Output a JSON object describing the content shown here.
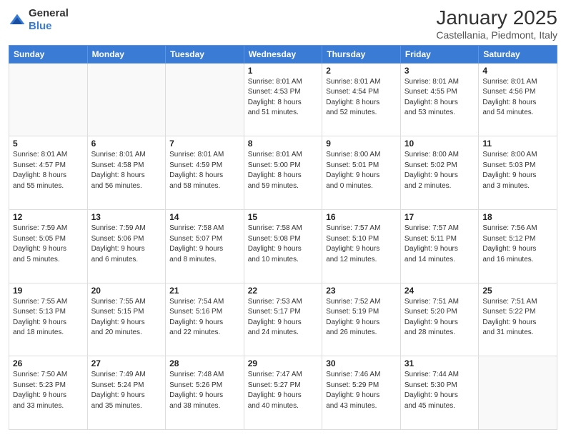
{
  "header": {
    "logo_general": "General",
    "logo_blue": "Blue",
    "month_year": "January 2025",
    "location": "Castellania, Piedmont, Italy"
  },
  "weekdays": [
    "Sunday",
    "Monday",
    "Tuesday",
    "Wednesday",
    "Thursday",
    "Friday",
    "Saturday"
  ],
  "weeks": [
    [
      {
        "day": "",
        "info": "",
        "empty": true
      },
      {
        "day": "",
        "info": "",
        "empty": true
      },
      {
        "day": "",
        "info": "",
        "empty": true
      },
      {
        "day": "1",
        "info": "Sunrise: 8:01 AM\nSunset: 4:53 PM\nDaylight: 8 hours\nand 51 minutes."
      },
      {
        "day": "2",
        "info": "Sunrise: 8:01 AM\nSunset: 4:54 PM\nDaylight: 8 hours\nand 52 minutes."
      },
      {
        "day": "3",
        "info": "Sunrise: 8:01 AM\nSunset: 4:55 PM\nDaylight: 8 hours\nand 53 minutes."
      },
      {
        "day": "4",
        "info": "Sunrise: 8:01 AM\nSunset: 4:56 PM\nDaylight: 8 hours\nand 54 minutes."
      }
    ],
    [
      {
        "day": "5",
        "info": "Sunrise: 8:01 AM\nSunset: 4:57 PM\nDaylight: 8 hours\nand 55 minutes."
      },
      {
        "day": "6",
        "info": "Sunrise: 8:01 AM\nSunset: 4:58 PM\nDaylight: 8 hours\nand 56 minutes."
      },
      {
        "day": "7",
        "info": "Sunrise: 8:01 AM\nSunset: 4:59 PM\nDaylight: 8 hours\nand 58 minutes."
      },
      {
        "day": "8",
        "info": "Sunrise: 8:01 AM\nSunset: 5:00 PM\nDaylight: 8 hours\nand 59 minutes."
      },
      {
        "day": "9",
        "info": "Sunrise: 8:00 AM\nSunset: 5:01 PM\nDaylight: 9 hours\nand 0 minutes."
      },
      {
        "day": "10",
        "info": "Sunrise: 8:00 AM\nSunset: 5:02 PM\nDaylight: 9 hours\nand 2 minutes."
      },
      {
        "day": "11",
        "info": "Sunrise: 8:00 AM\nSunset: 5:03 PM\nDaylight: 9 hours\nand 3 minutes."
      }
    ],
    [
      {
        "day": "12",
        "info": "Sunrise: 7:59 AM\nSunset: 5:05 PM\nDaylight: 9 hours\nand 5 minutes."
      },
      {
        "day": "13",
        "info": "Sunrise: 7:59 AM\nSunset: 5:06 PM\nDaylight: 9 hours\nand 6 minutes."
      },
      {
        "day": "14",
        "info": "Sunrise: 7:58 AM\nSunset: 5:07 PM\nDaylight: 9 hours\nand 8 minutes."
      },
      {
        "day": "15",
        "info": "Sunrise: 7:58 AM\nSunset: 5:08 PM\nDaylight: 9 hours\nand 10 minutes."
      },
      {
        "day": "16",
        "info": "Sunrise: 7:57 AM\nSunset: 5:10 PM\nDaylight: 9 hours\nand 12 minutes."
      },
      {
        "day": "17",
        "info": "Sunrise: 7:57 AM\nSunset: 5:11 PM\nDaylight: 9 hours\nand 14 minutes."
      },
      {
        "day": "18",
        "info": "Sunrise: 7:56 AM\nSunset: 5:12 PM\nDaylight: 9 hours\nand 16 minutes."
      }
    ],
    [
      {
        "day": "19",
        "info": "Sunrise: 7:55 AM\nSunset: 5:13 PM\nDaylight: 9 hours\nand 18 minutes."
      },
      {
        "day": "20",
        "info": "Sunrise: 7:55 AM\nSunset: 5:15 PM\nDaylight: 9 hours\nand 20 minutes."
      },
      {
        "day": "21",
        "info": "Sunrise: 7:54 AM\nSunset: 5:16 PM\nDaylight: 9 hours\nand 22 minutes."
      },
      {
        "day": "22",
        "info": "Sunrise: 7:53 AM\nSunset: 5:17 PM\nDaylight: 9 hours\nand 24 minutes."
      },
      {
        "day": "23",
        "info": "Sunrise: 7:52 AM\nSunset: 5:19 PM\nDaylight: 9 hours\nand 26 minutes."
      },
      {
        "day": "24",
        "info": "Sunrise: 7:51 AM\nSunset: 5:20 PM\nDaylight: 9 hours\nand 28 minutes."
      },
      {
        "day": "25",
        "info": "Sunrise: 7:51 AM\nSunset: 5:22 PM\nDaylight: 9 hours\nand 31 minutes."
      }
    ],
    [
      {
        "day": "26",
        "info": "Sunrise: 7:50 AM\nSunset: 5:23 PM\nDaylight: 9 hours\nand 33 minutes."
      },
      {
        "day": "27",
        "info": "Sunrise: 7:49 AM\nSunset: 5:24 PM\nDaylight: 9 hours\nand 35 minutes."
      },
      {
        "day": "28",
        "info": "Sunrise: 7:48 AM\nSunset: 5:26 PM\nDaylight: 9 hours\nand 38 minutes."
      },
      {
        "day": "29",
        "info": "Sunrise: 7:47 AM\nSunset: 5:27 PM\nDaylight: 9 hours\nand 40 minutes."
      },
      {
        "day": "30",
        "info": "Sunrise: 7:46 AM\nSunset: 5:29 PM\nDaylight: 9 hours\nand 43 minutes."
      },
      {
        "day": "31",
        "info": "Sunrise: 7:44 AM\nSunset: 5:30 PM\nDaylight: 9 hours\nand 45 minutes."
      },
      {
        "day": "",
        "info": "",
        "empty": true
      }
    ]
  ]
}
